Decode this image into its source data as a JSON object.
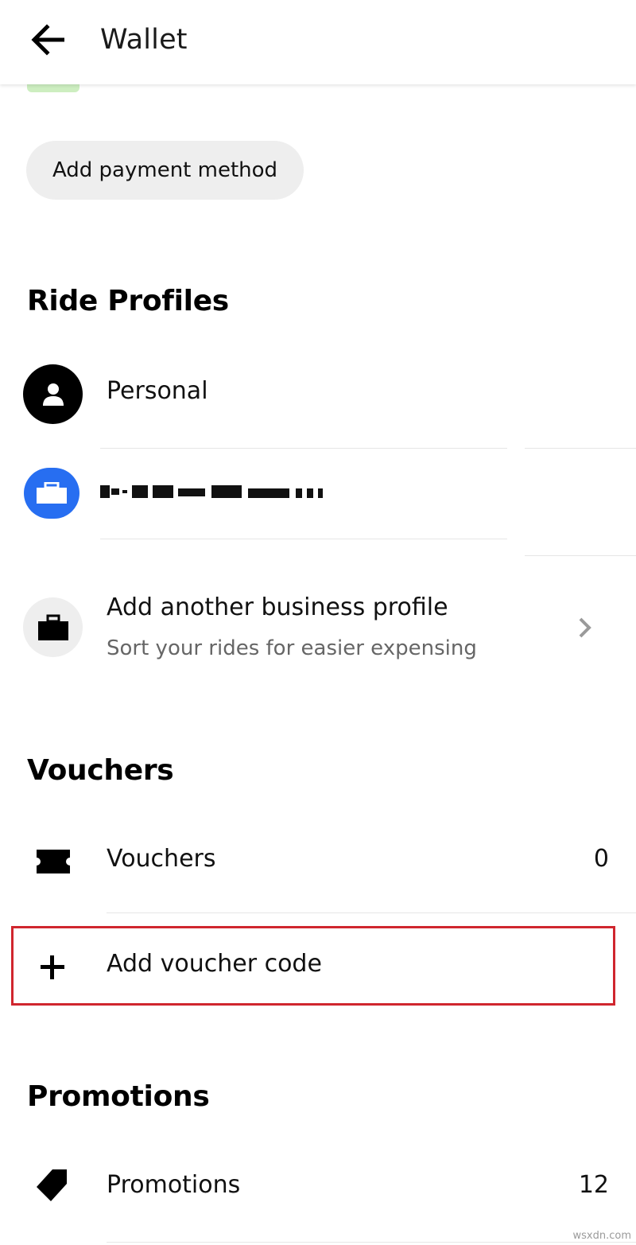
{
  "header": {
    "title": "Wallet"
  },
  "payment": {
    "add_label": "Add payment method"
  },
  "ride_profiles": {
    "title": "Ride Profiles",
    "personal_label": "Personal",
    "add_business_title": "Add another business profile",
    "add_business_subtitle": "Sort your rides for easier expensing"
  },
  "vouchers": {
    "title": "Vouchers",
    "row_label": "Vouchers",
    "count": "0",
    "add_code_label": "Add voucher code"
  },
  "promotions": {
    "title": "Promotions",
    "row_label": "Promotions",
    "count": "12"
  },
  "watermark": "wsxdn.com",
  "colors": {
    "business_blue": "#276EF1",
    "highlight_red": "#D0262E",
    "pill_gray": "#EEEEEE"
  },
  "icons": {
    "back": "arrow-left-icon",
    "personal": "person-icon",
    "business": "briefcase-icon",
    "chevron": "chevron-right-icon",
    "voucher": "ticket-icon",
    "add": "plus-icon",
    "promotion": "tag-icon"
  }
}
